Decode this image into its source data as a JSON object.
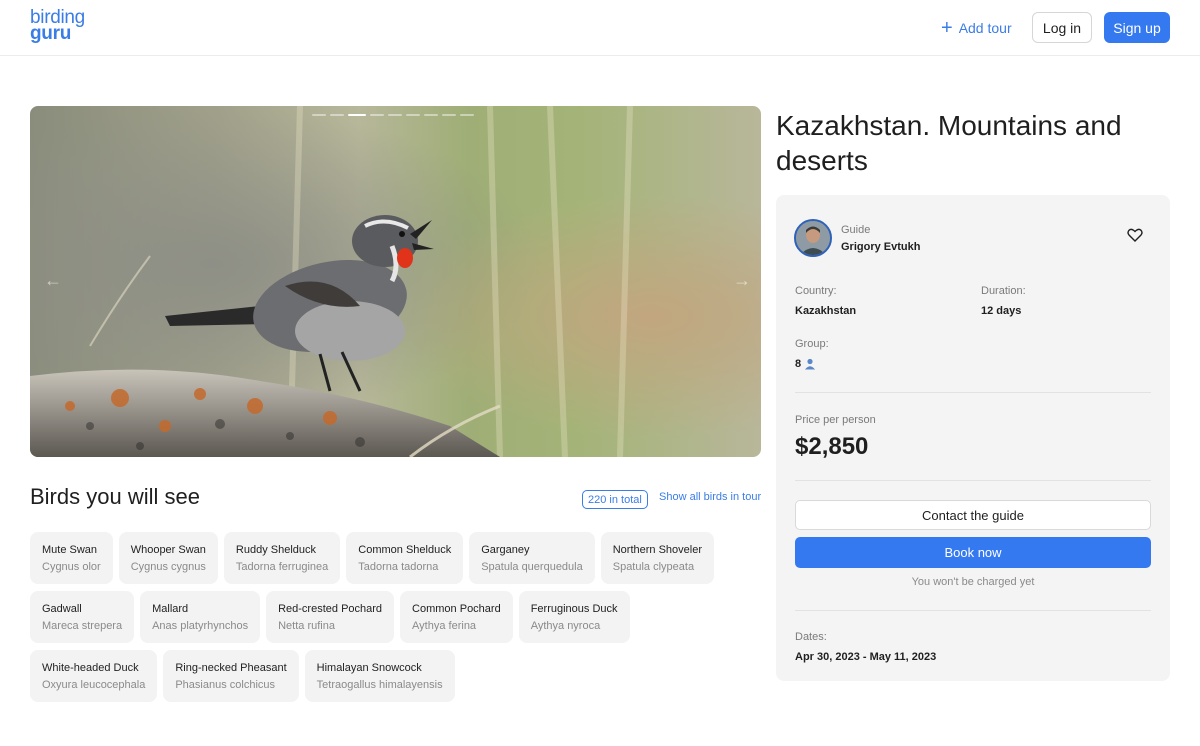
{
  "header": {
    "logo_line1": "birding",
    "logo_line2": "guru",
    "add_tour_label": "Add tour",
    "login_label": "Log in",
    "signup_label": "Sign up"
  },
  "gallery": {
    "slide_count": 9,
    "active_slide": 3,
    "prev_icon": "arrow-left-icon",
    "next_icon": "arrow-right-icon"
  },
  "birds": {
    "title": "Birds you will see",
    "total_badge": "220 in total",
    "show_all_label": "Show all birds in tour",
    "rows": [
      [
        {
          "en": "Mute Swan",
          "la": "Cygnus olor"
        },
        {
          "en": "Whooper Swan",
          "la": "Cygnus cygnus"
        },
        {
          "en": "Ruddy Shelduck",
          "la": "Tadorna ferruginea"
        },
        {
          "en": "Common Shelduck",
          "la": "Tadorna tadorna"
        },
        {
          "en": "Garganey",
          "la": "Spatula querquedula"
        },
        {
          "en": "Northern Shoveler",
          "la": "Spatula clypeata"
        }
      ],
      [
        {
          "en": "Gadwall",
          "la": "Mareca strepera"
        },
        {
          "en": "Mallard",
          "la": "Anas platyrhynchos"
        },
        {
          "en": "Red-crested Pochard",
          "la": "Netta rufina"
        },
        {
          "en": "Common Pochard",
          "la": "Aythya ferina"
        },
        {
          "en": "Ferruginous Duck",
          "la": "Aythya nyroca"
        }
      ],
      [
        {
          "en": "White-headed Duck",
          "la": "Oxyura leucocephala"
        },
        {
          "en": "Ring-necked Pheasant",
          "la": "Phasianus colchicus"
        },
        {
          "en": "Himalayan Snowcock",
          "la": "Tetraogallus himalayensis"
        }
      ]
    ]
  },
  "tour": {
    "title": "Kazakhstan. Mountains and deserts",
    "guide_label": "Guide",
    "guide_name": "Grigory Evtukh",
    "country_label": "Country:",
    "country_value": "Kazakhstan",
    "duration_label": "Duration:",
    "duration_value": "12 days",
    "group_label": "Group:",
    "group_value": "8",
    "price_label": "Price per person",
    "price_value": "$2,850",
    "contact_label": "Contact the guide",
    "book_label": "Book now",
    "charge_note": "You won't be charged yet",
    "dates_label": "Dates:",
    "dates_value": "Apr 30, 2023 - May 11, 2023"
  },
  "colors": {
    "accent": "#3479f0",
    "link": "#3b7de6",
    "card_bg": "#f4f4f4",
    "chip_bg": "#f3f3f3"
  }
}
